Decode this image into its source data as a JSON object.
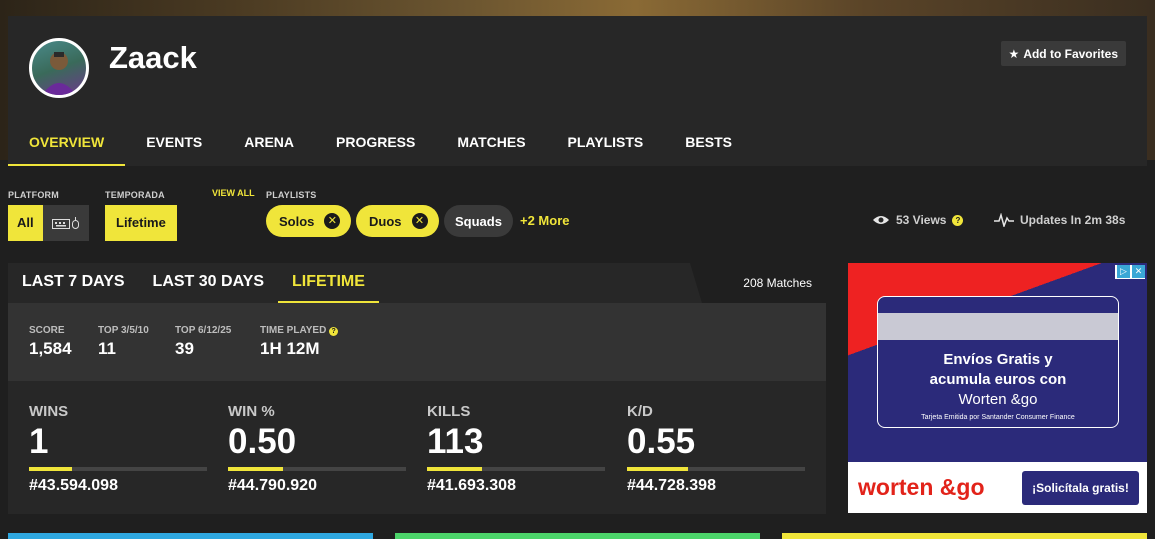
{
  "player": {
    "name": "Zaack"
  },
  "header": {
    "favorite_label": "Add to Favorites"
  },
  "tabs": [
    {
      "label": "OVERVIEW",
      "active": true
    },
    {
      "label": "EVENTS"
    },
    {
      "label": "ARENA"
    },
    {
      "label": "PROGRESS"
    },
    {
      "label": "MATCHES"
    },
    {
      "label": "PLAYLISTS"
    },
    {
      "label": "BESTS"
    }
  ],
  "filters": {
    "platform_label": "PLATFORM",
    "platform_all": "All",
    "temporada_label": "TEMPORADA",
    "temporada_value": "Lifetime",
    "view_all": "VIEW ALL",
    "playlists_label": "PLAYLISTS",
    "playlists": [
      "Solos",
      "Duos",
      "Squads"
    ],
    "more": "+2 More",
    "views": "53 Views",
    "updates": "Updates In 2m 38s"
  },
  "stats": {
    "ranges": [
      "LAST 7 DAYS",
      "LAST 30 DAYS",
      "LIFETIME"
    ],
    "active_range": "LIFETIME",
    "matches": "208 Matches",
    "summary": [
      {
        "label": "SCORE",
        "value": "1,584"
      },
      {
        "label": "TOP 3/5/10",
        "value": "11"
      },
      {
        "label": "TOP 6/12/25",
        "value": "39"
      },
      {
        "label": "TIME PLAYED",
        "value": "1H 12M"
      }
    ],
    "big": [
      {
        "label": "WINS",
        "value": "1",
        "rank": "#43.594.098",
        "fill_pct": 24
      },
      {
        "label": "WIN %",
        "value": "0.50",
        "rank": "#44.790.920",
        "fill_pct": 31
      },
      {
        "label": "KILLS",
        "value": "113",
        "rank": "#41.693.308",
        "fill_pct": 31
      },
      {
        "label": "K/D",
        "value": "0.55",
        "rank": "#44.728.398",
        "fill_pct": 34
      }
    ]
  },
  "ad": {
    "line1": "Envíos Gratis y",
    "line2": "acumula euros con",
    "line3": "Worten &go",
    "fine_print": "Tarjeta Emitida por Santander Consumer Finance",
    "brand": "worten &go",
    "cta": "¡Solicítala gratis!"
  },
  "colors": {
    "accent": "#f0e53a",
    "panel": "#272727",
    "background": "#1f1f1f"
  }
}
